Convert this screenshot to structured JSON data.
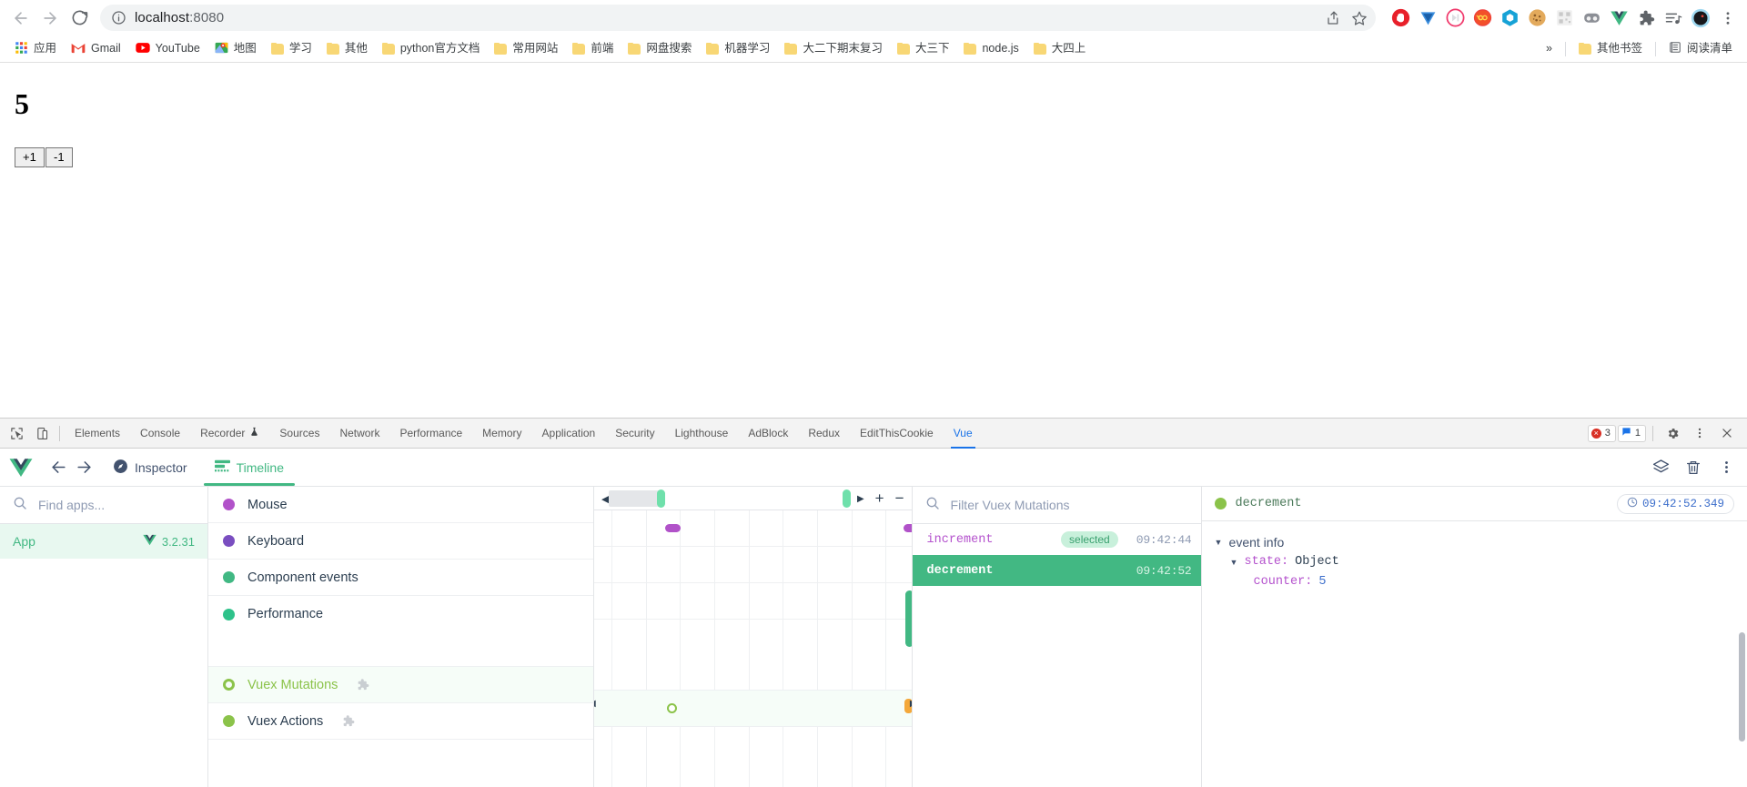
{
  "browser": {
    "url_host": "localhost",
    "url_port": ":8080",
    "back_icon": "back-arrow-icon",
    "forward_icon": "forward-arrow-icon",
    "reload_icon": "reload-icon",
    "info_icon": "site-info-icon",
    "share_icon": "share-icon",
    "bookmark_icon": "star-icon",
    "menu_icon": "three-dot-menu-icon",
    "extensions": [
      {
        "name": "adblock-extension-icon"
      },
      {
        "name": "tampermonkey-extension-icon"
      },
      {
        "name": "video-speed-extension-icon"
      },
      {
        "name": "infinity-extension-icon"
      },
      {
        "name": "hexagon-extension-icon"
      },
      {
        "name": "cookie-extension-icon"
      },
      {
        "name": "qrcode-extension-icon"
      },
      {
        "name": "dualsense-extension-icon"
      },
      {
        "name": "vue-devtools-extension-icon"
      },
      {
        "name": "puzzle-extensions-icon"
      },
      {
        "name": "media-list-icon"
      },
      {
        "name": "profile-avatar-icon"
      }
    ]
  },
  "bookmarks": {
    "items": [
      {
        "label": "应用",
        "icon": "apps-grid-icon"
      },
      {
        "label": "Gmail",
        "icon": "gmail-icon"
      },
      {
        "label": "YouTube",
        "icon": "youtube-icon"
      },
      {
        "label": "地图",
        "icon": "maps-icon"
      },
      {
        "label": "学习",
        "icon": "folder-icon"
      },
      {
        "label": "其他",
        "icon": "folder-icon"
      },
      {
        "label": "python官方文档",
        "icon": "folder-icon"
      },
      {
        "label": "常用网站",
        "icon": "folder-icon"
      },
      {
        "label": "前端",
        "icon": "folder-icon"
      },
      {
        "label": "网盘搜索",
        "icon": "folder-icon"
      },
      {
        "label": "机器学习",
        "icon": "folder-icon"
      },
      {
        "label": "大二下期末复习",
        "icon": "folder-icon"
      },
      {
        "label": "大三下",
        "icon": "folder-icon"
      },
      {
        "label": "node.js",
        "icon": "folder-icon"
      },
      {
        "label": "大四上",
        "icon": "folder-icon"
      }
    ],
    "overflow_label": "»",
    "other_bookmarks": "其他书签",
    "reading_list": "阅读清单"
  },
  "page": {
    "counter": "5",
    "increment_label": "+1",
    "decrement_label": "-1"
  },
  "devtools": {
    "inspect_icon": "inspect-element-icon",
    "device_icon": "device-toolbar-icon",
    "tabs": [
      {
        "label": "Elements",
        "active": false
      },
      {
        "label": "Console",
        "active": false
      },
      {
        "label": "Recorder",
        "active": false,
        "badge": "flask-icon"
      },
      {
        "label": "Sources",
        "active": false
      },
      {
        "label": "Network",
        "active": false
      },
      {
        "label": "Performance",
        "active": false
      },
      {
        "label": "Memory",
        "active": false
      },
      {
        "label": "Application",
        "active": false
      },
      {
        "label": "Security",
        "active": false
      },
      {
        "label": "Lighthouse",
        "active": false
      },
      {
        "label": "AdBlock",
        "active": false
      },
      {
        "label": "Redux",
        "active": false
      },
      {
        "label": "EditThisCookie",
        "active": false
      },
      {
        "label": "Vue",
        "active": true
      }
    ],
    "error_count": "3",
    "message_count": "1",
    "settings_icon": "gear-icon",
    "more_icon": "three-dot-menu-icon",
    "close_icon": "close-icon"
  },
  "vue": {
    "logo": "vue-logo-icon",
    "back_icon": "back-arrow-icon",
    "forward_icon": "forward-arrow-icon",
    "tabs": [
      {
        "label": "Inspector",
        "icon": "compass-icon",
        "active": false
      },
      {
        "label": "Timeline",
        "icon": "timeline-icon",
        "active": true
      }
    ],
    "header_actions": [
      {
        "name": "layers-icon"
      },
      {
        "name": "trash-icon"
      },
      {
        "name": "three-dot-menu-icon"
      }
    ],
    "apps": {
      "search_placeholder": "Find apps...",
      "search_icon": "search-icon",
      "items": [
        {
          "name": "App",
          "version": "3.2.31",
          "selected": true
        }
      ]
    },
    "layers": [
      {
        "label": "Mouse",
        "color": "#b152c9",
        "selected": false,
        "plugin": false
      },
      {
        "label": "Keyboard",
        "color": "#7a4ec0",
        "selected": false,
        "plugin": false
      },
      {
        "label": "Component events",
        "color": "#41b883",
        "selected": false,
        "plugin": false
      },
      {
        "label": "Performance",
        "color": "#2ec28a",
        "selected": false,
        "plugin": false
      },
      {
        "label": "Vuex Mutations",
        "color": "#8bc34a",
        "selected": true,
        "plugin": true
      },
      {
        "label": "Vuex Actions",
        "color": "#8bc34a",
        "selected": false,
        "plugin": true
      }
    ],
    "ruler": {
      "zoom_in_label": "+",
      "zoom_out_label": "−",
      "left_arrow": "◀",
      "right_arrow": "▶"
    },
    "events": {
      "filter_placeholder": "Filter Vuex Mutations",
      "filter_icon": "search-icon",
      "items": [
        {
          "name": "increment",
          "time": "09:42:44",
          "badge": "selected",
          "active": false
        },
        {
          "name": "decrement",
          "time": "09:42:52",
          "badge": "",
          "active": true
        }
      ]
    },
    "info": {
      "event_name": "decrement",
      "timestamp": "09:42:52.349",
      "clock_icon": "clock-icon",
      "section_label": "event info",
      "state_key": "state:",
      "state_value": "Object",
      "counter_key": "counter:",
      "counter_value": "5"
    }
  },
  "colors": {
    "vue_green": "#42b883",
    "accent_blue": "#1a73e8",
    "mutation_green": "#8bc34a",
    "mouse_purple": "#b152c9"
  }
}
